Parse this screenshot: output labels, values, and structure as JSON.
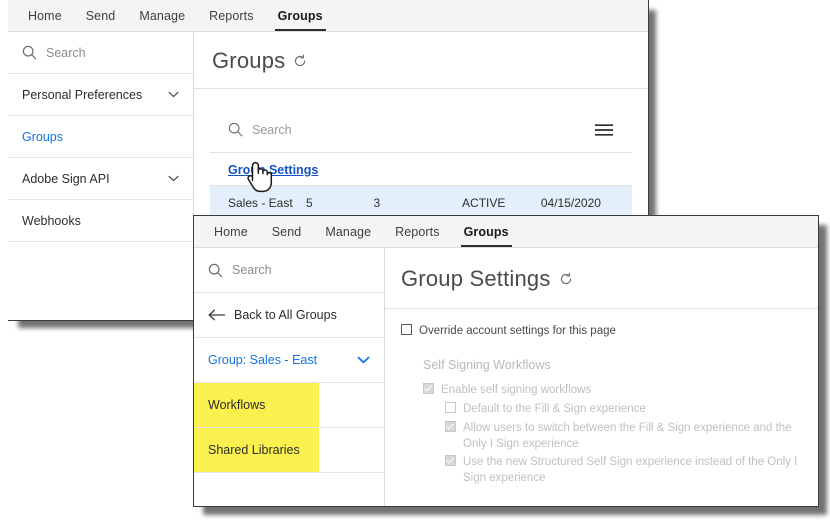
{
  "window1": {
    "topnav": {
      "items": [
        {
          "label": "Home",
          "active": false
        },
        {
          "label": "Send",
          "active": false
        },
        {
          "label": "Manage",
          "active": false
        },
        {
          "label": "Reports",
          "active": false
        },
        {
          "label": "Groups",
          "active": true
        }
      ]
    },
    "sidebar": {
      "search_placeholder": "Search",
      "items": [
        {
          "label": "Personal Preferences",
          "chevron": "chevron-down",
          "link": false
        },
        {
          "label": "Groups",
          "chevron": "",
          "link": true
        },
        {
          "label": "Adobe Sign API",
          "chevron": "chevron-down",
          "link": false
        },
        {
          "label": "Webhooks",
          "chevron": "",
          "link": false
        }
      ]
    },
    "page_title": "Groups",
    "refresh_icon": "refresh-icon",
    "search_placeholder": "Search",
    "menu_icon": "hamburger-menu-icon",
    "group_settings_link": "Group Settings",
    "table": {
      "row": [
        "Sales - East",
        "5",
        "3",
        "ACTIVE",
        "04/15/2020"
      ]
    }
  },
  "window2": {
    "topnav": {
      "items": [
        {
          "label": "Home",
          "active": false
        },
        {
          "label": "Send",
          "active": false
        },
        {
          "label": "Manage",
          "active": false
        },
        {
          "label": "Reports",
          "active": false
        },
        {
          "label": "Groups",
          "active": true
        }
      ]
    },
    "sidebar": {
      "search_placeholder": "Search",
      "back_label": "Back to All Groups",
      "group_label": "Group: Sales - East",
      "items": [
        {
          "label": "Workflows",
          "highlighted": true
        },
        {
          "label": "Shared Libraries",
          "highlighted": true
        }
      ]
    },
    "page_title": "Group Settings",
    "refresh_icon": "refresh-icon",
    "override_label": "Override account settings for this page",
    "section_label": "Self Signing Workflows",
    "options": [
      {
        "label": "Enable self signing workflows",
        "state": "checked",
        "indent": 1
      },
      {
        "label": "Default to the Fill & Sign experience",
        "state": "unchecked",
        "indent": 2
      },
      {
        "label": "Allow users to switch between the Fill & Sign experience and the Only I Sign experience",
        "state": "checked",
        "indent": 2
      },
      {
        "label": "Use the new Structured Self Sign experience instead of the Only I Sign experience",
        "state": "checked",
        "indent": 2
      }
    ]
  },
  "colors": {
    "link_blue": "#1473e6",
    "highlight_yellow": "#FBF14E",
    "row_selected_blue": "#e3effa",
    "nav_bar_gray": "#f4f4f4"
  }
}
